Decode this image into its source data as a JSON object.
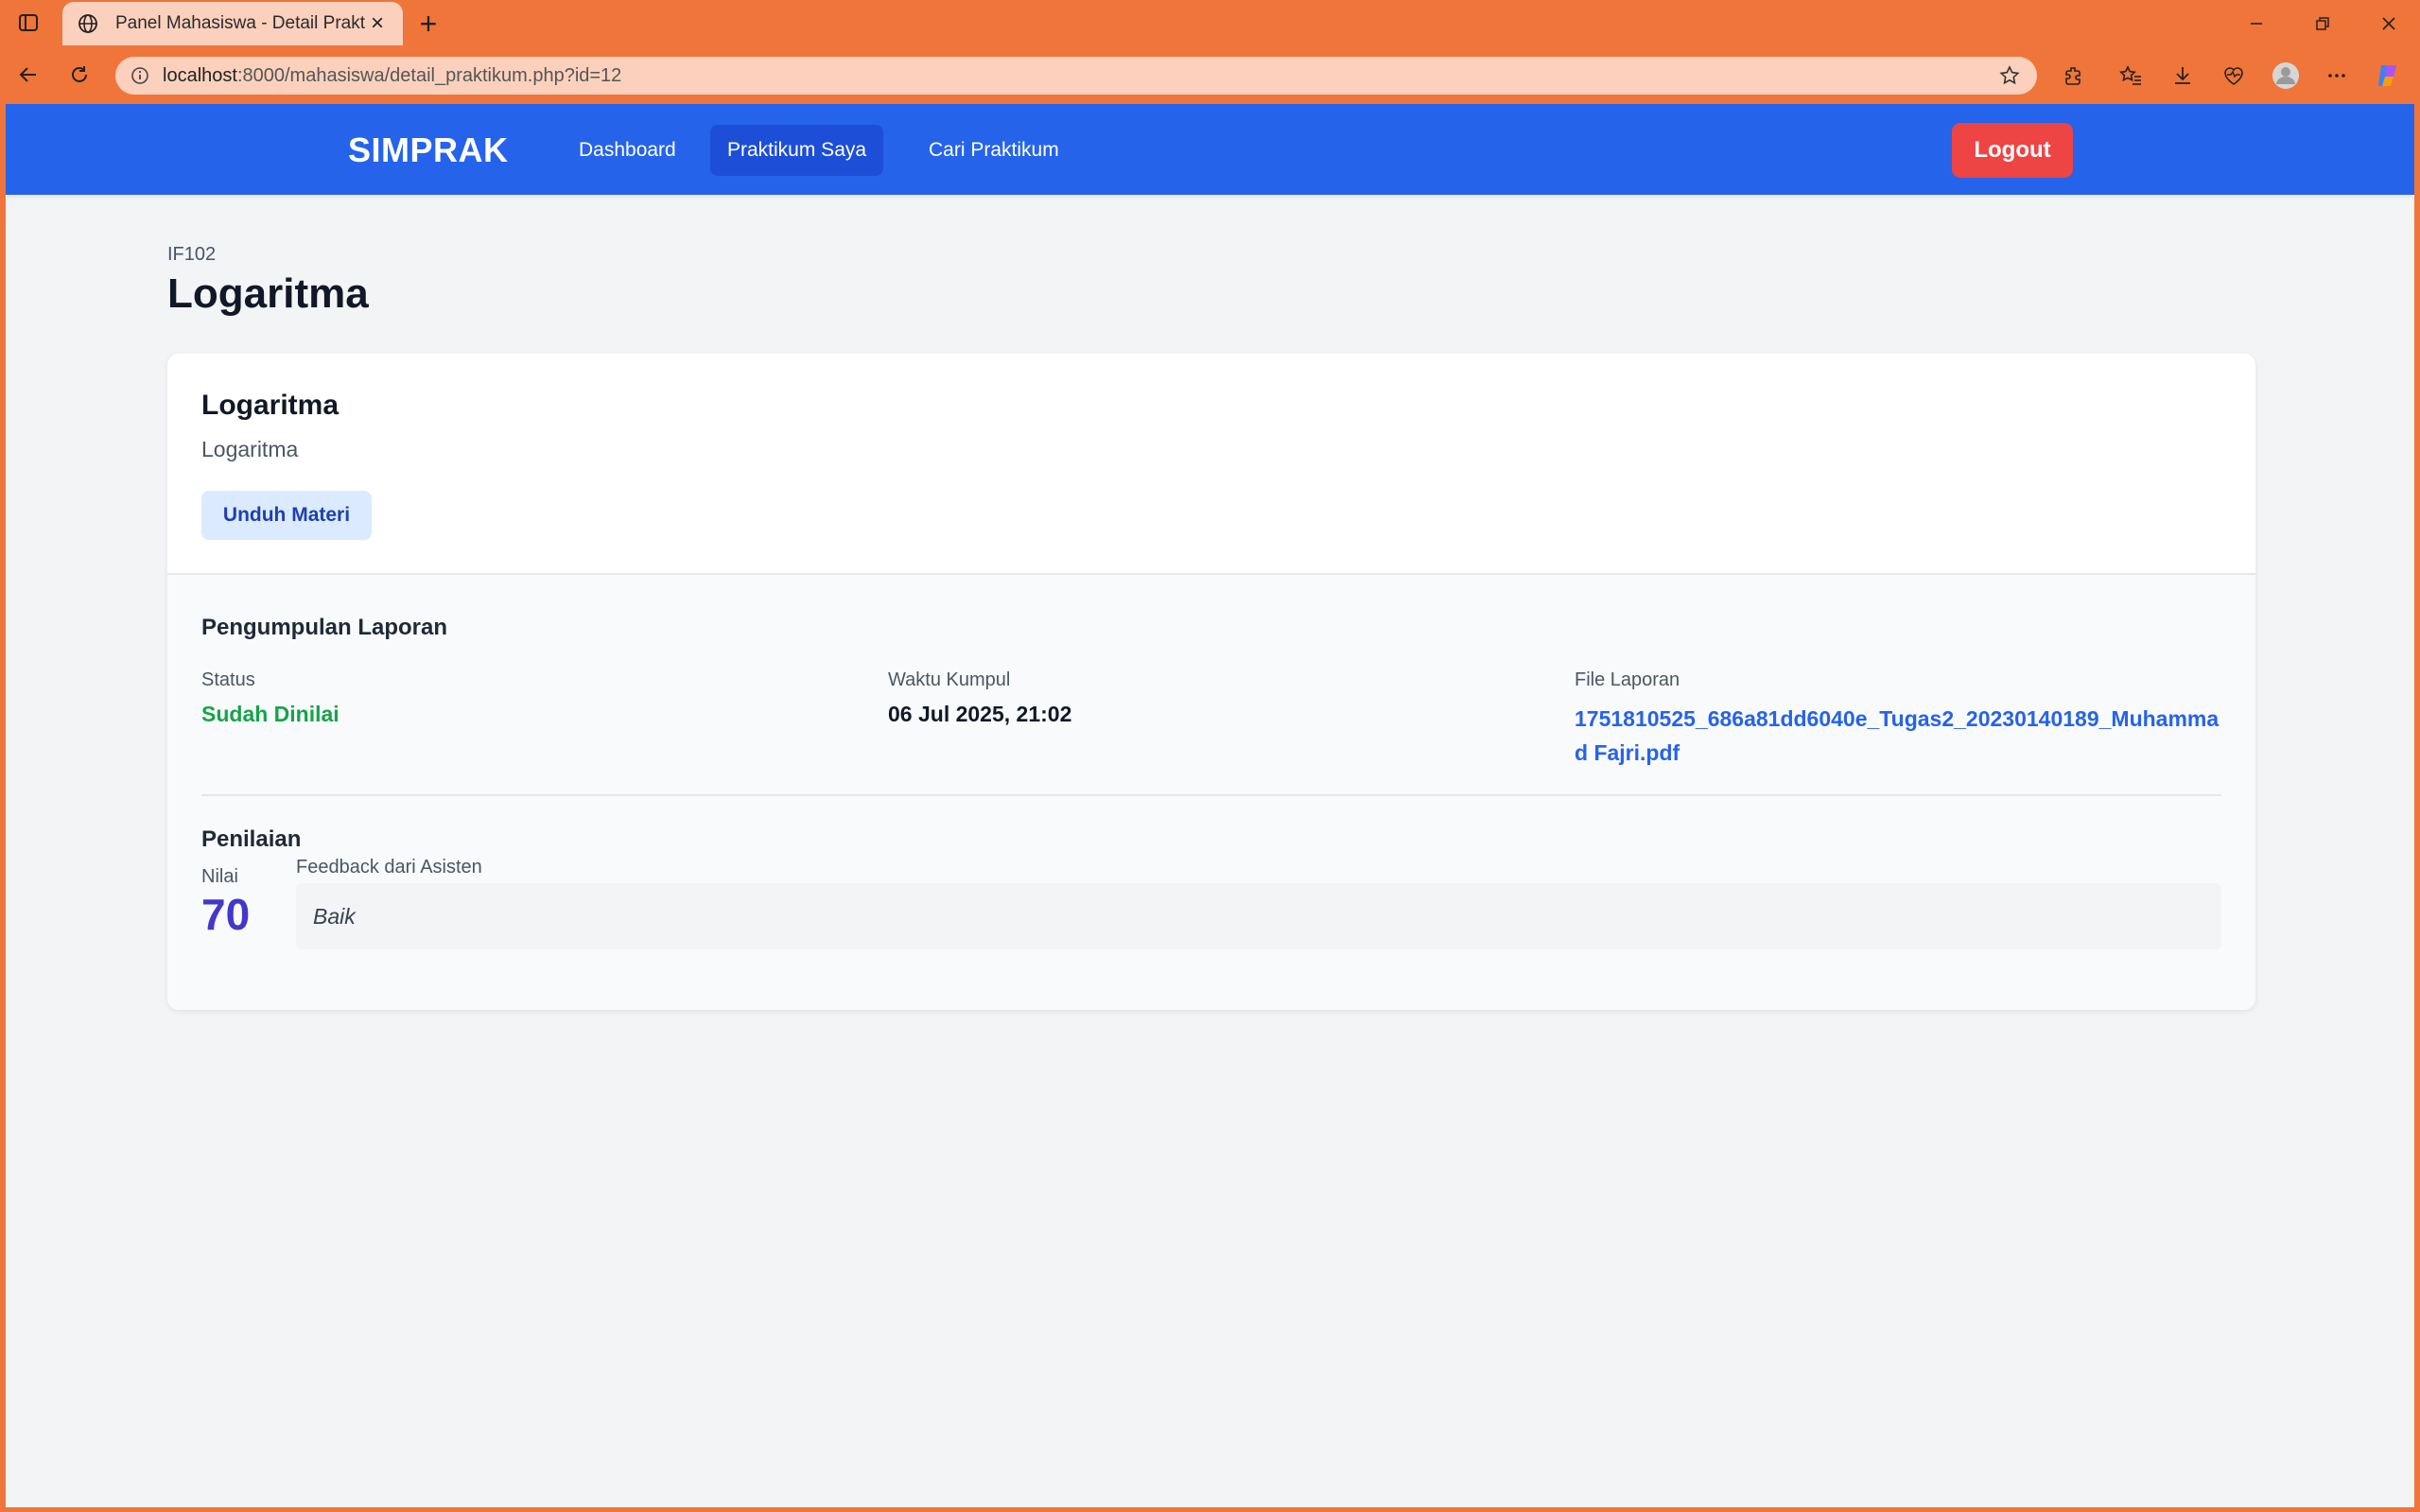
{
  "browser": {
    "tab_title": "Panel Mahasiswa - Detail Praktikum",
    "url_host": "localhost",
    "url_rest": ":8000/mahasiswa/detail_praktikum.php?id=12"
  },
  "nav": {
    "brand": "SIMPRAK",
    "links": [
      "Dashboard",
      "Praktikum Saya",
      "Cari Praktikum"
    ],
    "active_link": "Praktikum Saya",
    "logout": "Logout"
  },
  "header": {
    "course_code": "IF102",
    "title": "Logaritma"
  },
  "module": {
    "title": "Logaritma",
    "description": "Logaritma",
    "download_label": "Unduh Materi"
  },
  "submission": {
    "section_title": "Pengumpulan Laporan",
    "status_label": "Status",
    "status_value": "Sudah Dinilai",
    "time_label": "Waktu Kumpul",
    "time_value": "06 Jul 2025, 21:02",
    "file_label": "File Laporan",
    "file_name": "1751810525_686a81dd6040e_Tugas2_20230140189_Muhammad Fajri.pdf"
  },
  "grading": {
    "section_title": "Penilaian",
    "score_label": "Nilai",
    "score": "70",
    "feedback_label": "Feedback dari Asisten",
    "feedback": "Baik"
  },
  "colors": {
    "browser_accent": "#ef753a",
    "nav_bg": "#2563eb",
    "logout_bg": "#ef4444",
    "status_green": "#16a34a",
    "score_indigo": "#4338ca"
  }
}
